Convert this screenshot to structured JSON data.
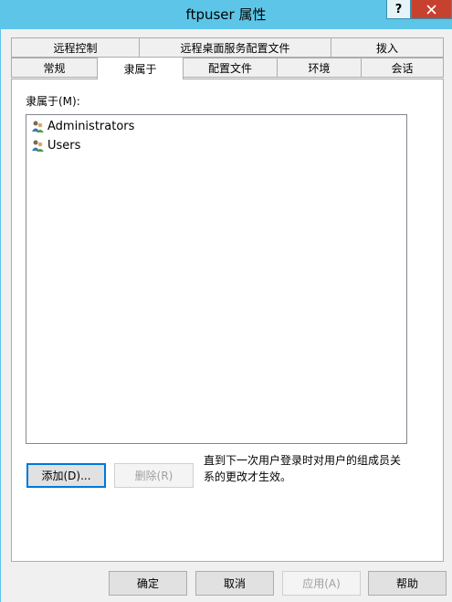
{
  "window": {
    "title": "ftpuser 属性",
    "help_label": "?",
    "close_label": "✕"
  },
  "tabs_row1": [
    {
      "label": "远程控制"
    },
    {
      "label": "远程桌面服务配置文件"
    },
    {
      "label": "拨入"
    }
  ],
  "tabs_row2": [
    {
      "label": "常规"
    },
    {
      "label": "隶属于",
      "active": true
    },
    {
      "label": "配置文件"
    },
    {
      "label": "环境"
    },
    {
      "label": "会话"
    }
  ],
  "member_of": {
    "label": "隶属于(M):",
    "items": [
      {
        "name": "Administrators",
        "icon": "group-icon"
      },
      {
        "name": "Users",
        "icon": "group-icon"
      }
    ],
    "add_label": "添加(D)...",
    "remove_label": "删除(R)",
    "note": "直到下一次用户登录时对用户的组成员关系的更改才生效。"
  },
  "footer": {
    "ok_label": "确定",
    "cancel_label": "取消",
    "apply_label": "应用(A)",
    "help_label": "帮助"
  },
  "colors": {
    "titlebar": "#5dc6e8",
    "close": "#c7412f",
    "focus": "#0078d7"
  }
}
